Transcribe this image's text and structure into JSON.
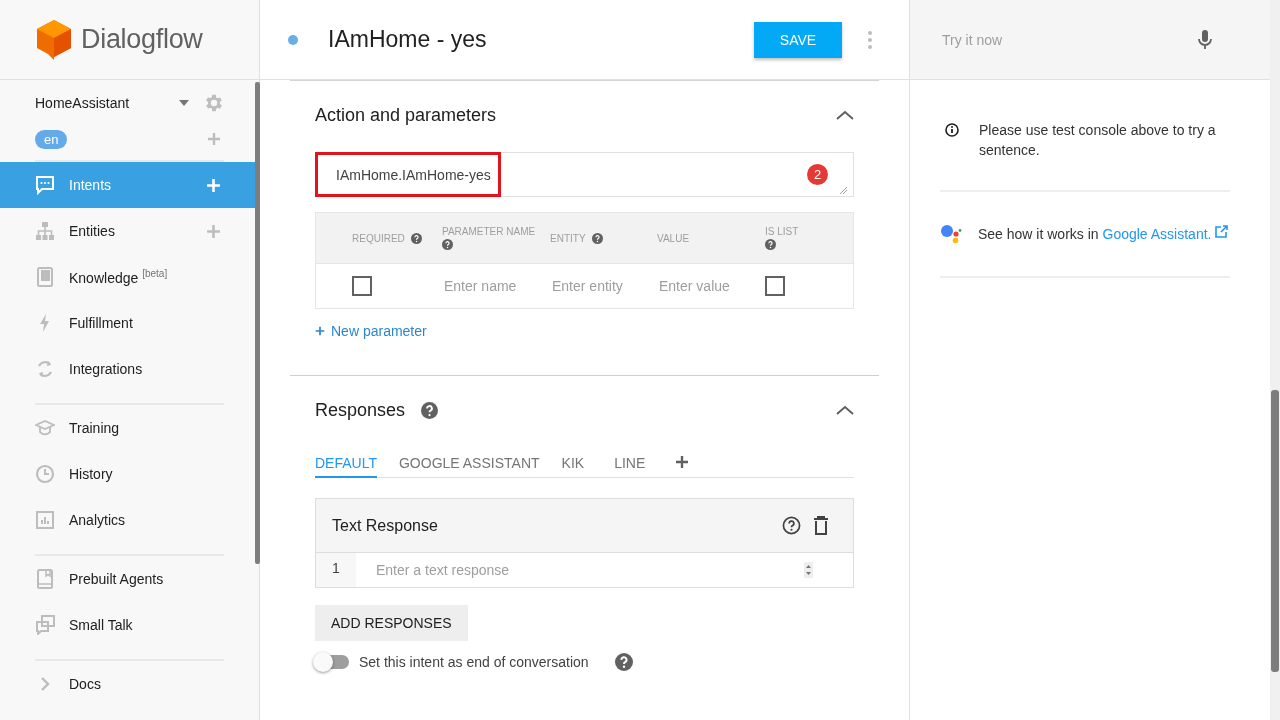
{
  "logo": {
    "name": "Dialogflow"
  },
  "agent": {
    "name": "HomeAssistant",
    "language": "en"
  },
  "nav_groups": [
    [
      {
        "label": "Intents",
        "selected": true,
        "add": true
      },
      {
        "label": "Entities",
        "selected": false,
        "add": true
      },
      {
        "label": "Knowledge $^{[beta]}$",
        "selected": false,
        "add": false
      },
      {
        "label": "Fulfillment",
        "selected": false,
        "add": false
      },
      {
        "label": "Integrations",
        "selected": false,
        "add": false
      }
    ],
    [
      {
        "label": "Training",
        "selected": false,
        "add": false
      },
      {
        "label": "History",
        "selected": false,
        "add": false
      },
      {
        "label": "Analytics",
        "selected": false,
        "add": false
      }
    ],
    [
      {
        "label": "Prebuilt Agents",
        "selected": false,
        "add": false
      },
      {
        "label": "Small Talk",
        "selected": false,
        "add": false
      }
    ],
    [
      {
        "label": "Docs",
        "selected": false,
        "add": false
      }
    ]
  ],
  "intent": {
    "title": "IAmHome - yes",
    "save": "SAVE"
  },
  "action_section": {
    "title": "Action and parameters",
    "expanded": true,
    "action": "IAmHome.IAmHome-yes",
    "highlighted": true,
    "badge": "2",
    "columns": [
      {
        "label": "REQUIRED",
        "help": true
      },
      {
        "label": "PARAMETER NAME",
        "help": true
      },
      {
        "label": "ENTITY",
        "help": true
      },
      {
        "label": "VALUE",
        "help": false
      },
      {
        "label": "IS LIST",
        "help": true
      }
    ],
    "row": {
      "required": false,
      "name_placeholder": "Enter name",
      "entity_placeholder": "Enter entity",
      "value_placeholder": "Enter value",
      "is_list": false
    },
    "new_parameter": "New parameter"
  },
  "responses": {
    "title": "Responses",
    "expanded": true,
    "tabs": [
      {
        "label": "DEFAULT",
        "selected": true
      },
      {
        "label": "GOOGLE ASSISTANT",
        "selected": false
      },
      {
        "label": "KIK",
        "selected": false
      },
      {
        "label": "LINE",
        "selected": false
      }
    ],
    "card_title": "Text Response",
    "line_number": "1",
    "placeholder": "Enter a text response",
    "add_button": "ADD RESPONSES",
    "end_toggle": {
      "label": "Set this intent as end of conversation",
      "on": false
    }
  },
  "console": {
    "placeholder": "Try it now",
    "info": "Please use test console above to try a sentence.",
    "assistant_text": "See how it works in",
    "assistant_link": "Google Assistant."
  }
}
